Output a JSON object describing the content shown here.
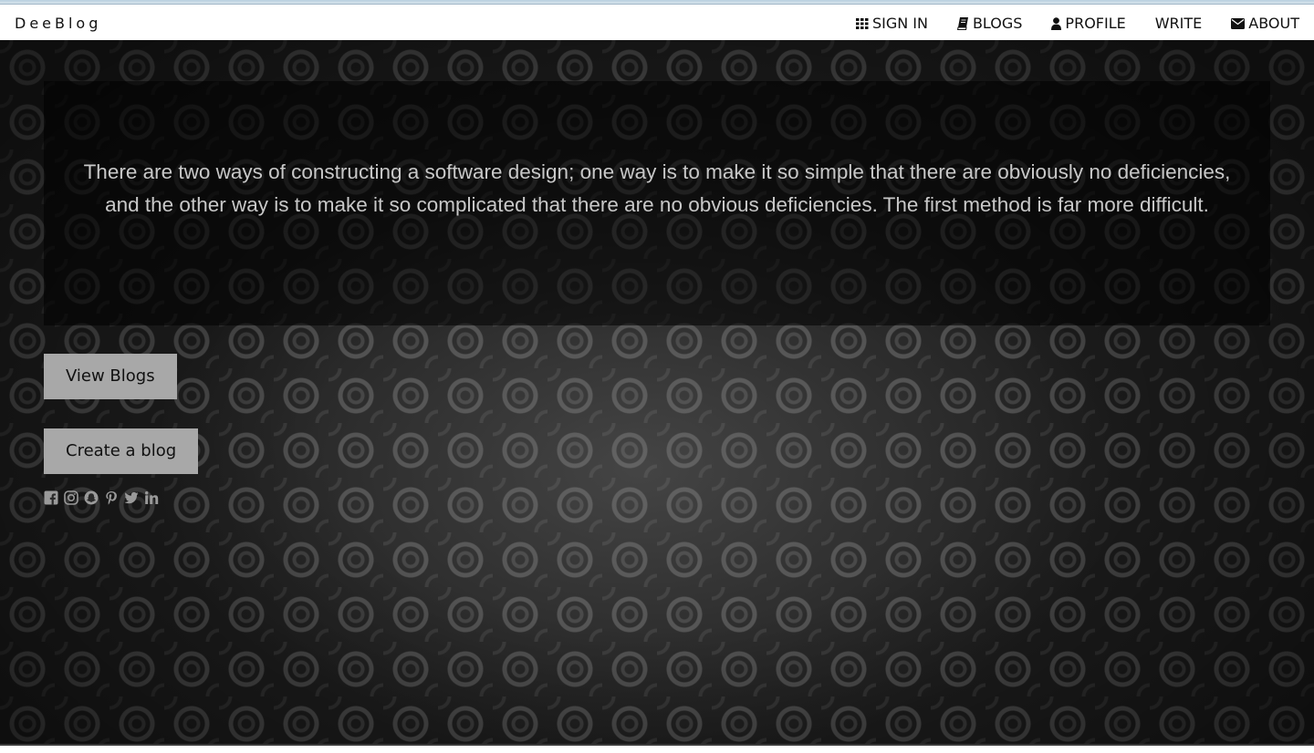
{
  "brand": {
    "title": "DeeBlog"
  },
  "nav": {
    "items": [
      {
        "label": "SIGN IN",
        "icon": "grid-icon"
      },
      {
        "label": "BLOGS",
        "icon": "book-icon"
      },
      {
        "label": "PROFILE",
        "icon": "user-icon"
      },
      {
        "label": "WRITE",
        "icon": ""
      },
      {
        "label": "ABOUT",
        "icon": "envelope-icon"
      }
    ]
  },
  "hero": {
    "quote": "There are two ways of constructing a software design; one way is to make it so simple that there are obviously no deficiencies, and the other way is to make it so complicated that there are no obvious deficiencies. The first method is far more difficult."
  },
  "buttons": {
    "view_blogs": "View Blogs",
    "create_blog": "Create a blog"
  },
  "social": {
    "icons": [
      "facebook-icon",
      "instagram-icon",
      "snapchat-icon",
      "pinterest-icon",
      "twitter-icon",
      "linkedin-icon"
    ]
  },
  "colors": {
    "button_bg": "#a8a8a8",
    "quote_text": "#c8c8c8",
    "social_icon": "#9a9a9a"
  }
}
